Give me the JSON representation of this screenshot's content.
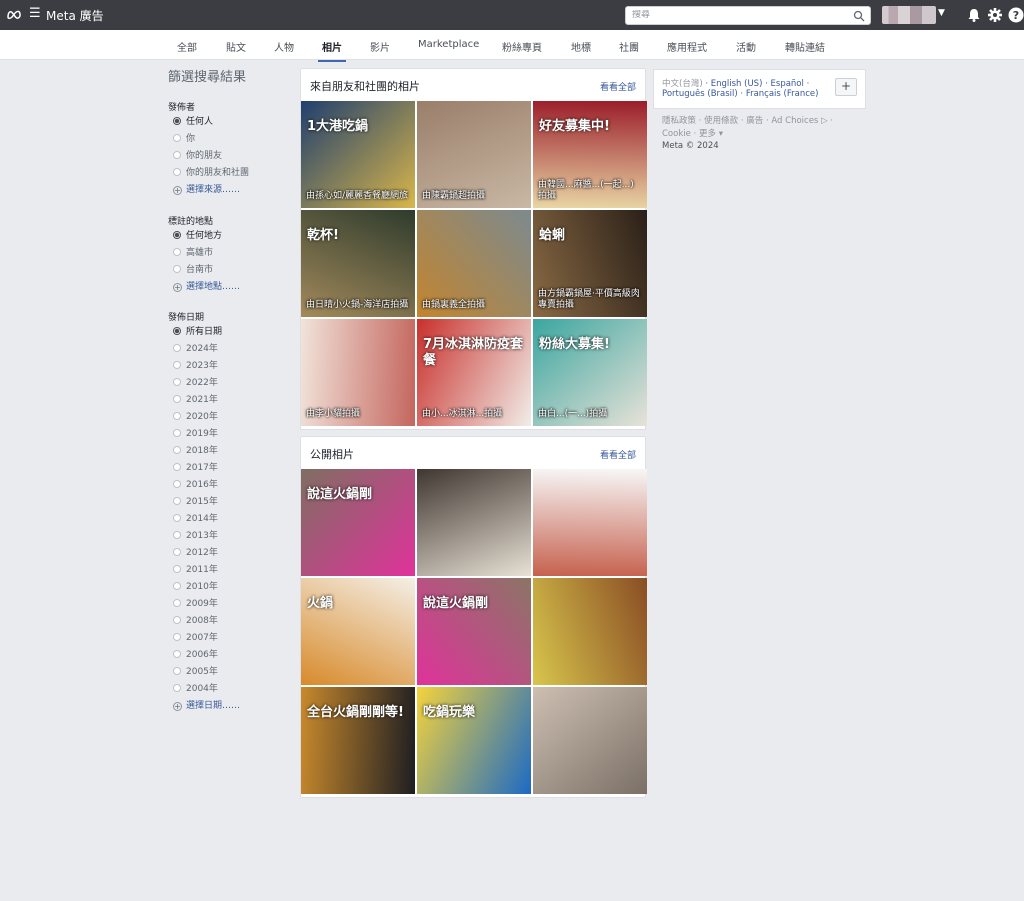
{
  "topbar": {
    "brand": "Meta 廣告",
    "search_placeholder": "搜尋"
  },
  "tabs": [
    "全部",
    "貼文",
    "人物",
    "相片",
    "影片",
    "Marketplace",
    "粉絲專頁",
    "地標",
    "社團",
    "應用程式",
    "活動",
    "轉貼連結"
  ],
  "active_tab": "相片",
  "filters": {
    "title": "篩選搜尋結果",
    "poster": {
      "title": "發佈者",
      "options": [
        "任何人",
        "你",
        "你的朋友",
        "你的朋友和社團"
      ],
      "link": "選擇來源……"
    },
    "location": {
      "title": "標註的地點",
      "options": [
        "任何地方",
        "高雄市",
        "台南市"
      ],
      "link": "選擇地點……"
    },
    "date": {
      "title": "發佈日期",
      "options": [
        "所有日期",
        "2024年",
        "2023年",
        "2022年",
        "2021年",
        "2020年",
        "2019年",
        "2018年",
        "2017年",
        "2016年",
        "2015年",
        "2014年",
        "2013年",
        "2012年",
        "2011年",
        "2010年",
        "2009年",
        "2008年",
        "2007年",
        "2006年",
        "2005年",
        "2004年"
      ],
      "link": "選擇日期……"
    }
  },
  "friends_photos": {
    "title": "來自朋友和社團的相片",
    "see_all": "看看全部",
    "photos": [
      {
        "caption": "由孫心如/麗麗香餐廳網旅",
        "text": "1大港吃鍋",
        "colors": [
          "#1f3f6e",
          "#d9b64a"
        ]
      },
      {
        "caption": "由陳霸鍋超拍攝",
        "text": "",
        "colors": [
          "#9a7e6a",
          "#c9b8a4"
        ]
      },
      {
        "caption": "由韓國...麻醬...(一起...) 拍攝",
        "text": "好友募集中!",
        "colors": [
          "#9b1d2a",
          "#e9d6a5"
        ]
      },
      {
        "caption": "由日晴小火鍋-海洋店拍攝",
        "text": "乾杯!",
        "colors": [
          "#2e3b2c",
          "#a38a5b"
        ]
      },
      {
        "caption": "由鍋裏義全拍攝",
        "text": "",
        "colors": [
          "#7c8a8f",
          "#c3852f"
        ]
      },
      {
        "caption": "由方鍋霸鍋屋·平價高級肉專賣拍攝",
        "text": "蛤蜊",
        "colors": [
          "#2a2018",
          "#8a6a44"
        ]
      },
      {
        "caption": "由李小貓拍攝",
        "text": "",
        "colors": [
          "#c4665e",
          "#f1e3da"
        ]
      },
      {
        "caption": "由小...冰淇淋...拍攝",
        "text": "7月冰淇淋防疫套餐",
        "colors": [
          "#f1ede8",
          "#c9302c"
        ]
      },
      {
        "caption": "由白...(一...)拍攝",
        "text": "粉絲大募集!",
        "colors": [
          "#e8e2d8",
          "#3aa6a0"
        ]
      }
    ]
  },
  "public_photos": {
    "title": "公開相片",
    "see_all": "看看全部",
    "photos": [
      {
        "text": "說這火鍋剛",
        "colors": [
          "#7f6e62",
          "#e0329b"
        ]
      },
      {
        "text": "",
        "colors": [
          "#3f3630",
          "#e8e1d5"
        ]
      },
      {
        "text": "",
        "colors": [
          "#f7f7f7",
          "#c6614e"
        ]
      },
      {
        "text": "火鍋",
        "colors": [
          "#f4efe6",
          "#d88a2b"
        ]
      },
      {
        "text": "說這火鍋剛",
        "colors": [
          "#8b7566",
          "#e0329b"
        ]
      },
      {
        "text": "",
        "colors": [
          "#8a4d24",
          "#d8c64c"
        ]
      },
      {
        "text": "全台火鍋剛剛等!",
        "colors": [
          "#1e1e22",
          "#c8892c"
        ]
      },
      {
        "text": "吃鍋玩樂",
        "colors": [
          "#1c6ac4",
          "#f5d33b"
        ]
      },
      {
        "text": "",
        "colors": [
          "#7b7066",
          "#cdbfb2"
        ]
      }
    ]
  },
  "languages": {
    "current": "中文(台灣)",
    "others": [
      "English (US)",
      "Español",
      "Português (Brasil)",
      "Français (France)"
    ],
    "add": "+"
  },
  "footer": {
    "links": [
      "隱私政策",
      "使用條款",
      "廣告",
      "Ad Choices",
      "Cookie",
      "更多"
    ],
    "copyright": "Meta © 2024"
  }
}
